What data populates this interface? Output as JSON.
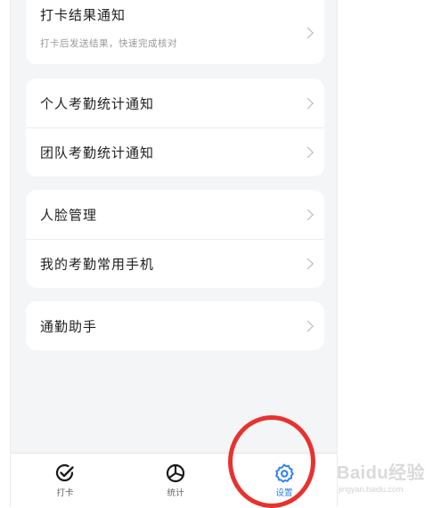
{
  "cards": [
    {
      "rows": [
        {
          "label": "打卡结果通知",
          "sub": "打卡后发送结果，快速完成核对"
        }
      ]
    },
    {
      "rows": [
        {
          "label": "个人考勤统计通知"
        },
        {
          "label": "团队考勤统计通知"
        }
      ]
    },
    {
      "rows": [
        {
          "label": "人脸管理"
        },
        {
          "label": "我的考勤常用手机"
        }
      ]
    },
    {
      "rows": [
        {
          "label": "通勤助手"
        }
      ]
    }
  ],
  "tabbar": {
    "tabs": [
      {
        "label": "打卡",
        "icon": "checkin-icon",
        "active": false
      },
      {
        "label": "统计",
        "icon": "stats-pie-icon",
        "active": false
      },
      {
        "label": "设置",
        "icon": "gear-icon",
        "active": true
      }
    ]
  },
  "colors": {
    "accent": "#2a7ff2",
    "highlight": "#e8322f"
  },
  "watermark": {
    "text": "Baidu经验",
    "url": "jingyan.baidu.com"
  }
}
